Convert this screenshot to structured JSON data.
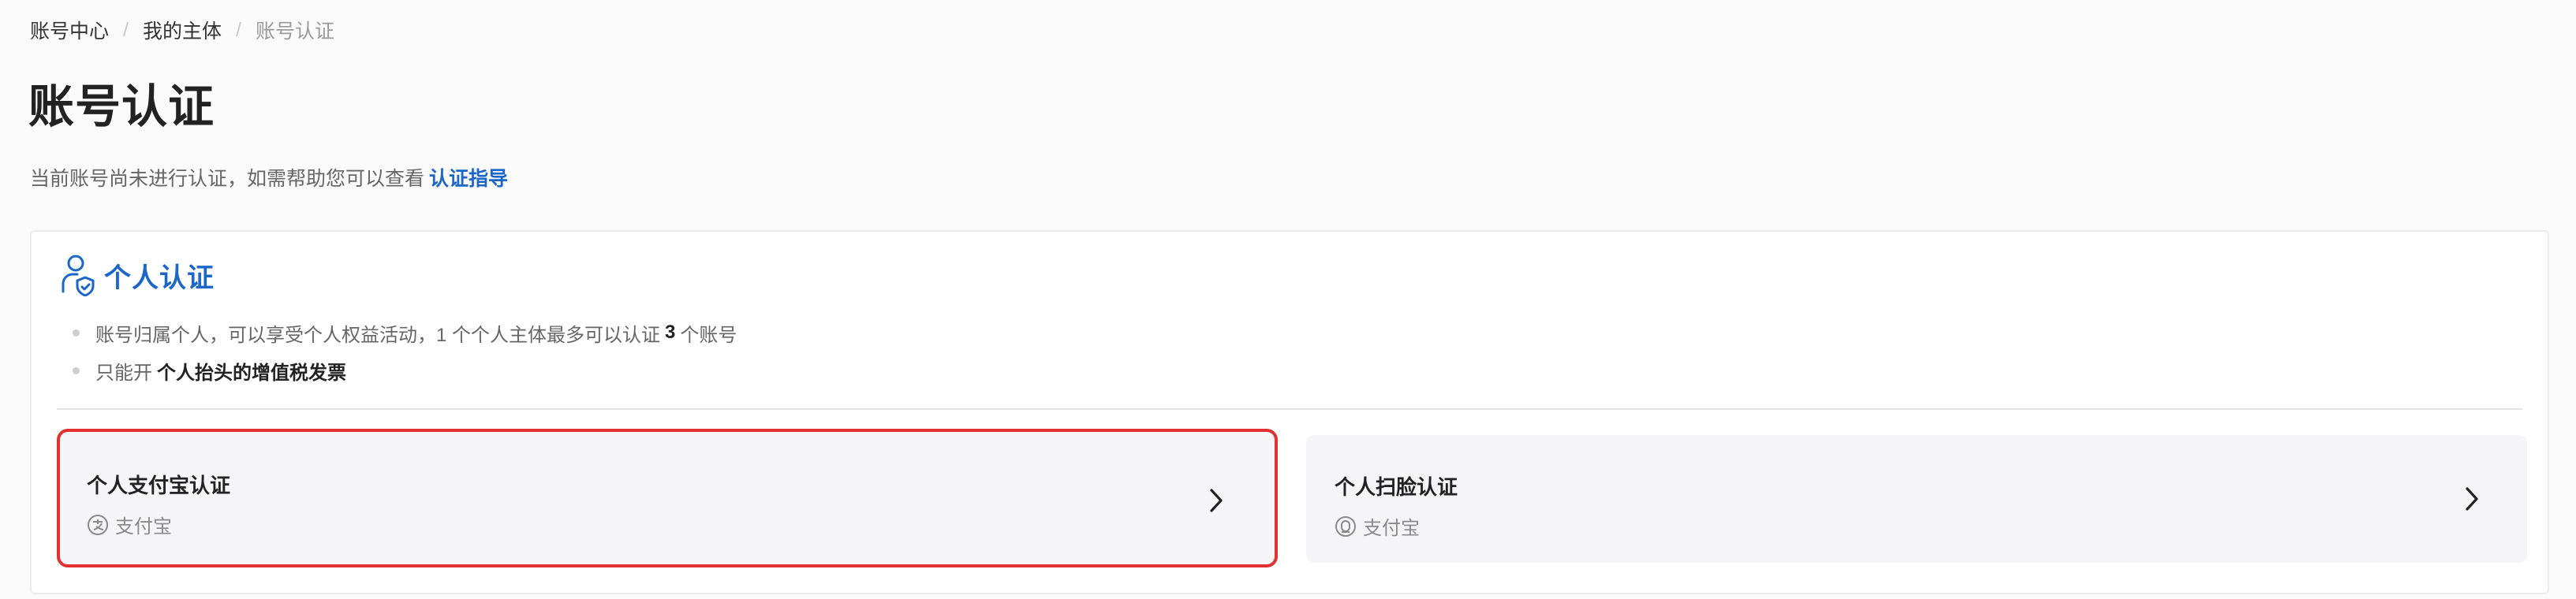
{
  "breadcrumb": {
    "items": [
      "账号中心",
      "我的主体",
      "账号认证"
    ],
    "separator": "/"
  },
  "page": {
    "title": "账号认证",
    "notice_text": "当前账号尚未进行认证，如需帮助您可以查看",
    "notice_link": "认证指导"
  },
  "card": {
    "title": "个人认证",
    "bullet1_prefix": "账号归属个人，可以享受个人权益活动，1 个个人主体最多可以认证",
    "bullet1_count": "3",
    "bullet1_suffix": "个账号",
    "bullet2_prefix": "只能开",
    "bullet2_bold": "个人抬头的增值税发票"
  },
  "options": {
    "alipay": {
      "title": "个人支付宝认证",
      "sub": "支付宝",
      "icon": "alipay-icon",
      "highlighted": true
    },
    "face": {
      "title": "个人扫脸认证",
      "sub": "支付宝",
      "icon": "face-scan-icon",
      "highlighted": false
    }
  },
  "colors": {
    "accent": "#1a66c9",
    "highlight_border": "#e33030",
    "option_bg": "#f5f5f7"
  }
}
